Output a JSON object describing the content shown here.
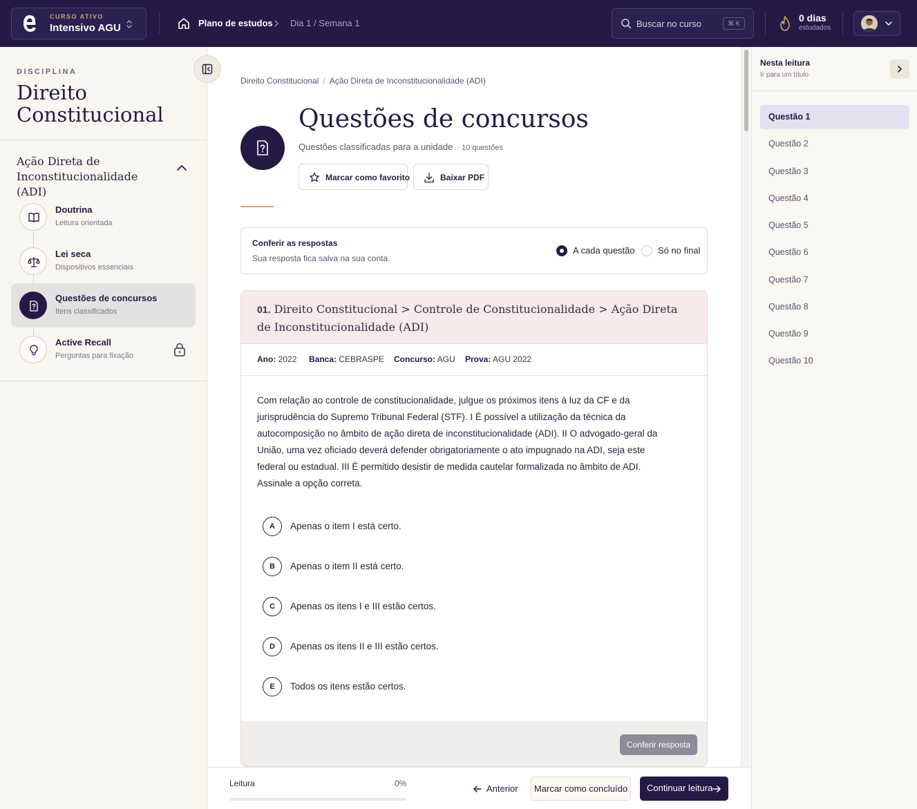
{
  "topbar": {
    "course_kicker": "CURSO ATIVO",
    "course_name": "Intensivo AGU",
    "breadcrumb_plan": "Plano de estudos",
    "breadcrumb_day": "Dia 1 / Semana 1",
    "search_placeholder": "Buscar no curso",
    "search_shortcut": "⌘ K",
    "streak_value": "0 dias",
    "streak_label": "estudados"
  },
  "sidebar": {
    "kicker": "DISCIPLINA",
    "discipline": "Direito Constitucional",
    "topic": "Ação Direta de Inconstitucionalidade (ADI)",
    "steps": [
      {
        "title": "Doutrina",
        "subtitle": "Leitura orientada",
        "icon": "book-icon",
        "active": false
      },
      {
        "title": "Lei seca",
        "subtitle": "Dispositivos essenciais",
        "icon": "scale-icon",
        "active": false
      },
      {
        "title": "Questões de concursos",
        "subtitle": "Itens classificados",
        "icon": "question-file-icon",
        "active": true
      },
      {
        "title": "Active Recall",
        "subtitle": "Perguntas para fixação",
        "icon": "lightbulb-icon",
        "active": false,
        "locked": true
      }
    ]
  },
  "main": {
    "breadcrumb": [
      "Direito Constitucional",
      "Ação Direta de Inconstitucionalidade (ADI)"
    ],
    "title": "Questões de concursos",
    "subtitle": "Questões classificadas para a unidade",
    "count": "· 10 questões",
    "favorite_label": "Marcar como favorito",
    "pdf_label": "Baixar PDF",
    "check_title": "Conferir as respostas",
    "check_sub": "Sua resposta fica salva na sua conta.",
    "check_options": [
      "A cada questão",
      "Só no final"
    ],
    "check_selected": "A cada questão"
  },
  "question": {
    "number": "01.",
    "path": "Direito Constitucional > Controle de Constitucionalidade > Ação Direta de Inconstitucionalidade (ADI)",
    "meta": {
      "ano_label": "Ano:",
      "ano": "2022",
      "banca_label": "Banca:",
      "banca": "CEBRASPE",
      "concurso_label": "Concurso:",
      "concurso": "AGU",
      "prova_label": "Prova:",
      "prova": "AGU 2022"
    },
    "statement": "Com relação ao controle de constitucionalidade, julgue os próximos itens à luz da CF e da jurisprudência do Supremo Tribunal Federal (STF). I É possível a utilização da técnica da autocomposição no âmbito de ação direta de inconstitucionalidade (ADI). II O advogado-geral da União, uma vez oficiado deverá defender obrigatoriamente o ato impugnado na ADI, seja este federal ou estadual. III É permitido desistir de medida cautelar formalizada no âmbito de ADI. Assinale a opção correta.",
    "options": [
      {
        "letter": "A",
        "text": "Apenas o item I está certo."
      },
      {
        "letter": "B",
        "text": "Apenas o item II está certo."
      },
      {
        "letter": "C",
        "text": "Apenas os itens I e III estão certos."
      },
      {
        "letter": "D",
        "text": "Apenas os itens II e III estão certos."
      },
      {
        "letter": "E",
        "text": "Todos os itens estão certos."
      }
    ],
    "submit_label": "Conferir resposta"
  },
  "progress": {
    "label": "Leitura",
    "percent_text": "0%",
    "value": 0,
    "prev_label": "Anterior",
    "done_label": "Marcar como concluído",
    "continue_label": "Continuar leitura"
  },
  "outline": {
    "title": "Nesta leitura",
    "subtitle": "Ir para um título",
    "items": [
      "Questão 1",
      "Questão 2",
      "Questão 3",
      "Questão 4",
      "Questão 5",
      "Questão 6",
      "Questão 7",
      "Questão 8",
      "Questão 9",
      "Questão 10"
    ],
    "active": "Questão 1"
  },
  "colors": {
    "brand": "#241a45",
    "accent_gold": "#c9a86a",
    "question_header": "#f8e9ea"
  }
}
